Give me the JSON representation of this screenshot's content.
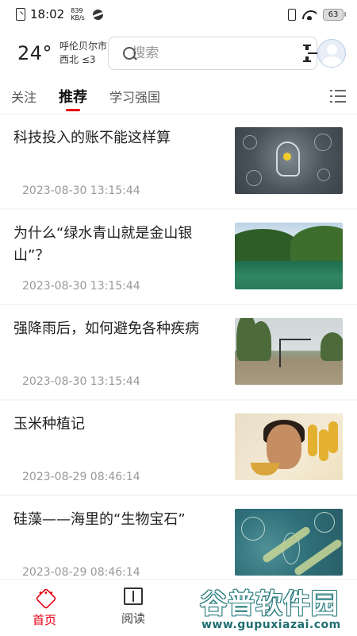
{
  "status_bar": {
    "time": "18:02",
    "net_speed_value": "839",
    "net_speed_unit": "KB/s",
    "battery": "63"
  },
  "header": {
    "temperature": "24°",
    "city": "呼伦贝尔市",
    "wind": "西北 ≤3",
    "search_placeholder": "搜索"
  },
  "tabs": [
    {
      "label": "关注",
      "active": false
    },
    {
      "label": "推荐",
      "active": true
    },
    {
      "label": "学习强国",
      "active": false
    }
  ],
  "feed": [
    {
      "title": "科技投入的账不能这样算",
      "date": "2023-08-30 13:15:44",
      "image": "tech-brain-image"
    },
    {
      "title": "为什么“绿水青山就是金山银山”？",
      "date": "2023-08-30 13:15:44",
      "image": "green-lake-image"
    },
    {
      "title": "强降雨后，如何避免各种疾病",
      "date": "2023-08-30 13:15:44",
      "image": "flooded-street-image"
    },
    {
      "title": "玉米种植记",
      "date": "2023-08-29 08:46:14",
      "image": "corn-painting-image"
    },
    {
      "title": "硅藻——海里的“生物宝石”",
      "date": "2023-08-29 08:46:14",
      "image": "diatom-image"
    }
  ],
  "bottom_nav": [
    {
      "label": "首页",
      "active": true
    },
    {
      "label": "阅读",
      "active": false
    }
  ],
  "watermark": {
    "main": "谷普软件园",
    "url": "www.gupuxiazai.com"
  },
  "colors": {
    "accent": "#e60012",
    "watermark": "#2a7c7d"
  }
}
